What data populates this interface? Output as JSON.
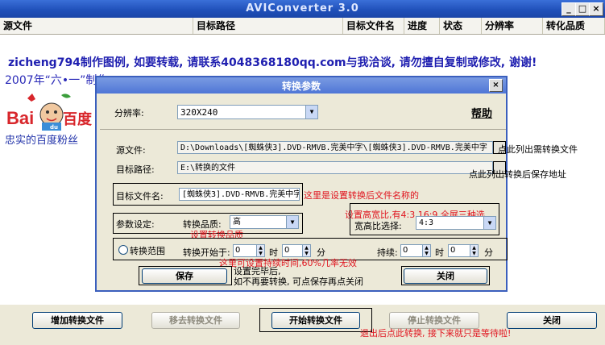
{
  "window": {
    "title": "AVIConverter 3.0"
  },
  "list_header": {
    "columns": [
      "源文件",
      "目标路径",
      "目标文件名",
      "进度",
      "状态",
      "分辨率",
      "转化品质"
    ]
  },
  "notice": {
    "text": "zicheng794制作图例, 如要转载, 请联系4048368180qq.com与我洽谈, 请勿擅自复制或修改, 谢谢!"
  },
  "made_date": "2007年“六•一”制作",
  "baidu": {
    "logo_text": "Bai百度",
    "slogan": "忠实的百度粉丝"
  },
  "dialog": {
    "title": "转换参数",
    "resolution_label": "分辨率:",
    "resolution_value": "320X240",
    "help_label": "帮助",
    "source_label": "源文件:",
    "source_value": "D:\\Downloads\\[蜘蛛侠3].DVD-RMVB.完美中字\\[蜘蛛侠3].DVD-RMVB.完美中字",
    "target_path_label": "目标路径:",
    "target_path_value": "E:\\转换的文件",
    "target_name_label": "目标文件名:",
    "target_name_value": "[蜘蛛侠3].DVD-RMVB.完美中字",
    "params_label": "参数设定:",
    "quality_label": "转换品质:",
    "quality_value": "高",
    "aspect_label": "宽高比选择:",
    "aspect_value": "4:3",
    "range_label": "转换范围",
    "start_label": "转换开始于:",
    "start_min": "0",
    "start_sec": "0",
    "duration_label": "持续:",
    "dur_min": "0",
    "dur_sec": "0",
    "min_unit": "时",
    "sec_unit": "分",
    "save_button": "保存",
    "close_button": "关闭"
  },
  "annotations": {
    "source_note": "点此列出需转换文件",
    "target_note": "点此列出转换后保存地址",
    "name_note": "这里是设置转换后文件名称的",
    "aspect_note": "设置高宽比,有4:3,16:9,全屏三种选",
    "quality_note": "设置转换品质",
    "range_note": "这里可设置持续时间,60%几率无效",
    "save_note_line1": "设置完毕后,",
    "save_note_line2": "如不再要转换, 可点保存再点关闭",
    "bottom_note": "退出后点此转换, 接下来就只是等待啦!"
  },
  "bottom_buttons": {
    "add": "增加转换文件",
    "remove": "移去转换文件",
    "start": "开始转换文件",
    "stop": "停止转换文件",
    "close": "关闭"
  },
  "colors": {
    "title_bar": "#1f4fb8",
    "annotation": "#e0141e",
    "notice": "#1f1fb0"
  }
}
